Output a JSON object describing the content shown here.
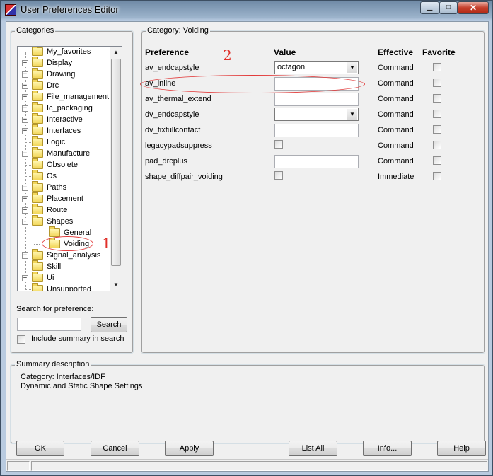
{
  "window": {
    "title": "User Preferences Editor"
  },
  "categories": {
    "legend": "Categories",
    "tree": [
      {
        "label": "My_favorites",
        "expander": ""
      },
      {
        "label": "Display",
        "expander": "+"
      },
      {
        "label": "Drawing",
        "expander": "+"
      },
      {
        "label": "Drc",
        "expander": "+"
      },
      {
        "label": "File_management",
        "expander": "+"
      },
      {
        "label": "Ic_packaging",
        "expander": "+"
      },
      {
        "label": "Interactive",
        "expander": "+"
      },
      {
        "label": "Interfaces",
        "expander": "+"
      },
      {
        "label": "Logic",
        "expander": ""
      },
      {
        "label": "Manufacture",
        "expander": "+"
      },
      {
        "label": "Obsolete",
        "expander": ""
      },
      {
        "label": "Os",
        "expander": ""
      },
      {
        "label": "Paths",
        "expander": "+"
      },
      {
        "label": "Placement",
        "expander": "+"
      },
      {
        "label": "Route",
        "expander": "+"
      },
      {
        "label": "Shapes",
        "expander": "-"
      },
      {
        "label": "General",
        "expander": ""
      },
      {
        "label": "Voiding",
        "expander": ""
      },
      {
        "label": "Signal_analysis",
        "expander": "+"
      },
      {
        "label": "Skill",
        "expander": ""
      },
      {
        "label": "Ui",
        "expander": "+"
      },
      {
        "label": "Unsupported",
        "expander": ""
      }
    ],
    "search_label": "Search for preference:",
    "search_value": "",
    "search_button": "Search",
    "include_summary_label": "Include summary in search"
  },
  "category_panel": {
    "legend": "Category:  Voiding",
    "headers": {
      "preference": "Preference",
      "value": "Value",
      "effective": "Effective",
      "favorite": "Favorite"
    },
    "rows": [
      {
        "name": "av_endcapstyle",
        "value": "octagon",
        "effective": "Command"
      },
      {
        "name": "av_inline",
        "value": "",
        "effective": "Command"
      },
      {
        "name": "av_thermal_extend",
        "value": "",
        "effective": "Command"
      },
      {
        "name": "dv_endcapstyle",
        "value": "",
        "effective": "Command"
      },
      {
        "name": "dv_fixfullcontact",
        "value": "",
        "effective": "Command"
      },
      {
        "name": "legacypadsuppress",
        "value": "",
        "effective": "Command"
      },
      {
        "name": "pad_drcplus",
        "value": "",
        "effective": "Command"
      },
      {
        "name": "shape_diffpair_voiding",
        "value": "",
        "effective": "Immediate"
      }
    ]
  },
  "summary": {
    "legend": "Summary description",
    "line1": "Category: Interfaces/IDF",
    "line2": "Dynamic and Static Shape Settings"
  },
  "buttons": {
    "ok": "OK",
    "cancel": "Cancel",
    "apply": "Apply",
    "list_all": "List All",
    "info": "Info...",
    "help": "Help"
  },
  "annotations": {
    "one": "1",
    "two": "2"
  },
  "colors": {
    "annotation": "#e0302a",
    "tree_folder": "#f2d659"
  }
}
